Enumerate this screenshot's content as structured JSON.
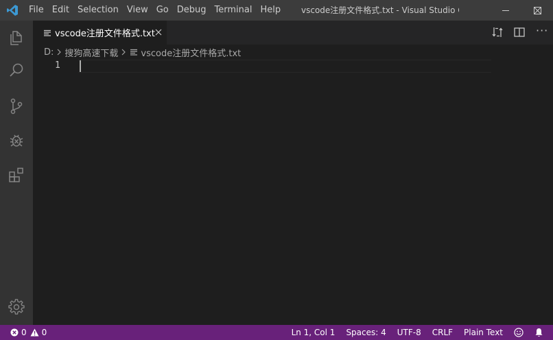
{
  "titlebar": {
    "menu": [
      "File",
      "Edit",
      "Selection",
      "View",
      "Go",
      "Debug",
      "Terminal",
      "Help"
    ],
    "window_title": "vscode注册文件格式.txt - Visual Studio C..."
  },
  "tab": {
    "label": "vscode注册文件格式.txt"
  },
  "breadcrumb": {
    "drive": "D:",
    "folder": "搜狗高速下载",
    "file": "vscode注册文件格式.txt"
  },
  "editor": {
    "line_number": "1"
  },
  "statusbar": {
    "errors": "0",
    "warnings": "0",
    "position": "Ln 1, Col 1",
    "spaces": "Spaces: 4",
    "encoding": "UTF-8",
    "eol": "CRLF",
    "language": "Plain Text"
  },
  "colors": {
    "accent": "#68217a",
    "logo": "#3c99d4"
  },
  "icons": [
    "vscode-logo-icon",
    "files-icon",
    "search-icon",
    "source-control-icon",
    "debug-icon",
    "extensions-icon",
    "gear-icon",
    "file-lines-icon",
    "close-icon",
    "compare-icon",
    "split-editor-icon",
    "smiley-icon",
    "bell-icon",
    "error-icon",
    "warning-icon",
    "chevron-right-icon"
  ]
}
